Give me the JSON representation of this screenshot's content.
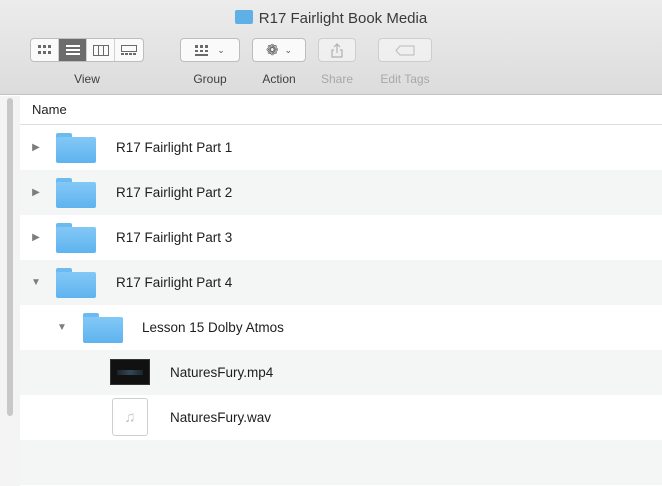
{
  "window": {
    "title": "R17 Fairlight Book Media"
  },
  "toolbar": {
    "view_label": "View",
    "group_label": "Group",
    "action_label": "Action",
    "share_label": "Share",
    "edit_tags_label": "Edit Tags"
  },
  "list": {
    "column_name": "Name",
    "rows": [
      {
        "label": "R17 Fairlight Part 1",
        "kind": "folder",
        "expanded": false
      },
      {
        "label": "R17 Fairlight Part 2",
        "kind": "folder",
        "expanded": false
      },
      {
        "label": "R17 Fairlight Part 3",
        "kind": "folder",
        "expanded": false
      },
      {
        "label": "R17 Fairlight Part 4",
        "kind": "folder",
        "expanded": true
      },
      {
        "label": "Lesson 15 Dolby Atmos",
        "kind": "folder",
        "expanded": true
      },
      {
        "label": "NaturesFury.mp4",
        "kind": "video"
      },
      {
        "label": "NaturesFury.wav",
        "kind": "audio"
      }
    ]
  },
  "colors": {
    "folder": "#6cbbf0",
    "alt_row": "#f4f5f5",
    "active_segment": "#6c6c6c"
  }
}
